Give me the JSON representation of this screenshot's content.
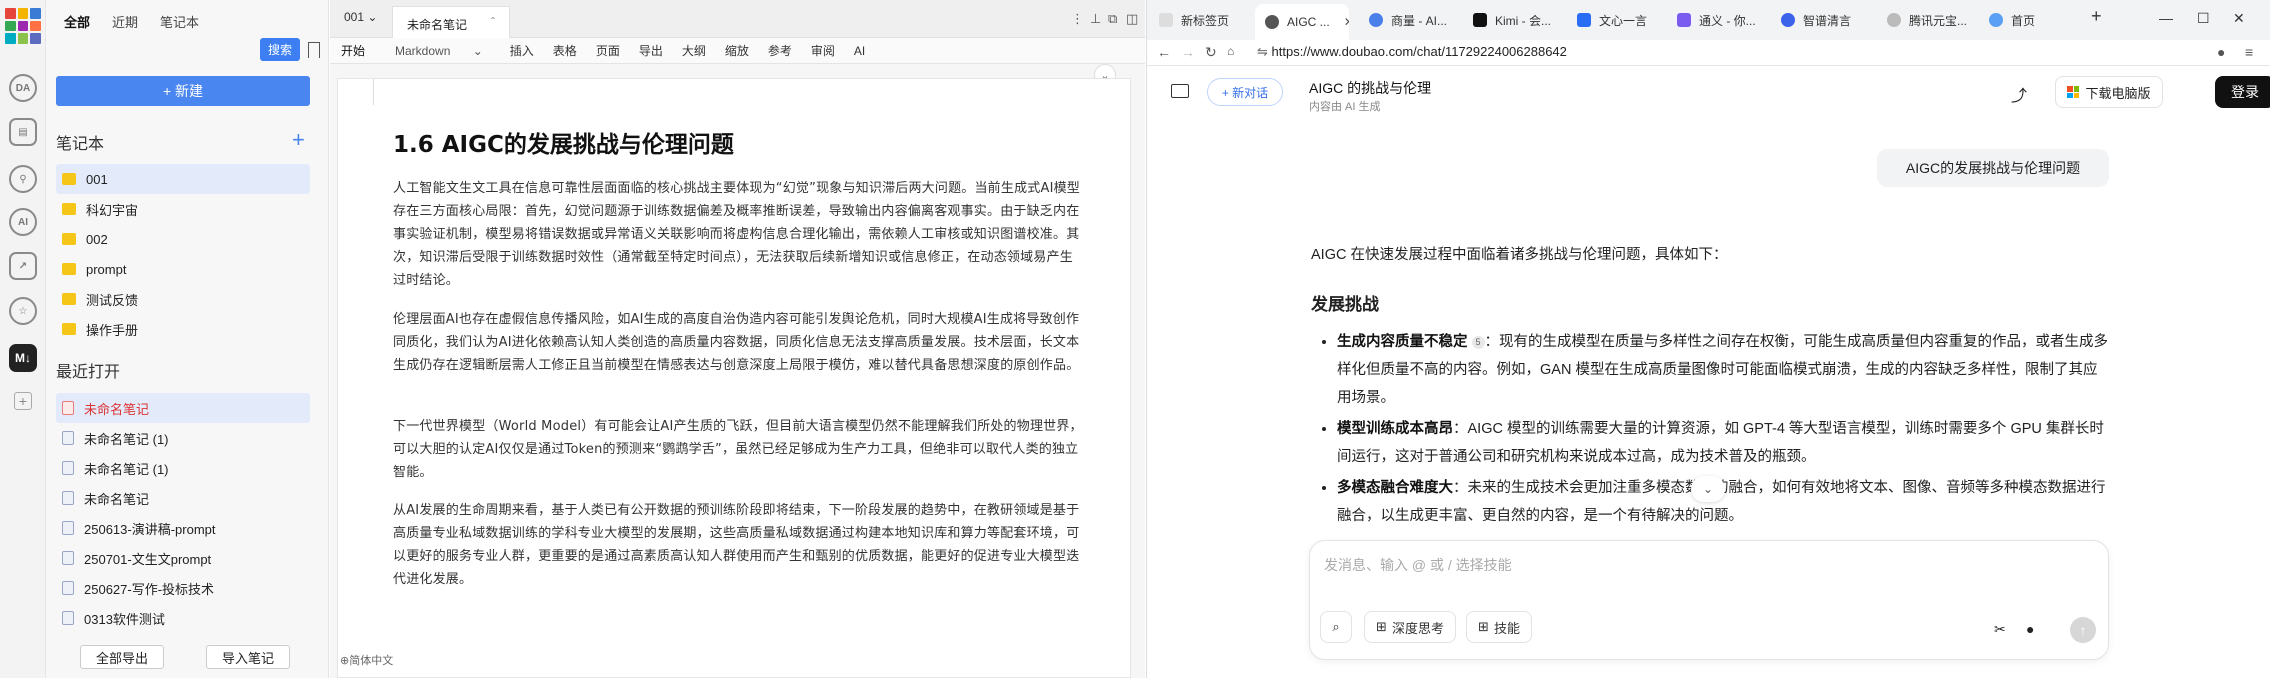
{
  "colors": {
    "accent": "#4a86f0",
    "selected_bg": "#e3ebfb",
    "folder": "#f5c518",
    "login_bg": "#111111"
  },
  "rail": {
    "icons": [
      "app-logo",
      "openai-icon",
      "note-icon",
      "search-icon",
      "ai-icon",
      "chart-icon",
      "star-icon",
      "markdown-icon",
      "add-icon"
    ],
    "md_label": "M↓"
  },
  "sidebar": {
    "tabs": [
      "全部",
      "近期",
      "笔记本"
    ],
    "search_label": "搜索",
    "new_label": "+ 新建",
    "notebooks_title": "笔记本",
    "notebooks": [
      "001",
      "科幻宇宙",
      "002",
      "prompt",
      "测试反馈",
      "操作手册"
    ],
    "recent_title": "最近打开",
    "recent": [
      "未命名笔记",
      "未命名笔记 (1)",
      "未命名笔记 (1)",
      "未命名笔记",
      "250613-演讲稿-prompt",
      "250701-文生文prompt",
      "250627-写作-投标技术",
      "0313软件测试"
    ],
    "export_all": "全部导出",
    "import": "导入笔记"
  },
  "editor": {
    "tab_folder": "001",
    "tab_title": "未命名笔记",
    "menu": [
      "开始",
      "Markdown",
      "插入",
      "表格",
      "页面",
      "导出",
      "大纲",
      "缩放",
      "参考",
      "审阅",
      "AI"
    ],
    "heading": "1.6 AIGC的发展挑战与伦理问题",
    "paragraphs": [
      "人工智能文生文工具在信息可靠性层面面临的核心挑战主要体现为“幻觉”现象与知识滞后两大问题。当前生成式AI模型存在三方面核心局限：首先，幻觉问题源于训练数据偏差及概率推断误差，导致输出内容偏离客观事实。由于缺乏内在事实验证机制，模型易将错误数据或异常语义关联影响而将虚构信息合理化输出，需依赖人工审核或知识图谱校准。其次，知识滞后受限于训练数据时效性（通常截至特定时间点），无法获取后续新增知识或信息修正，在动态领域易产生过时结论。",
      "伦理层面AI也存在虚假信息传播风险，如AI生成的高度自治伪造内容可能引发舆论危机，同时大规模AI生成将导致创作同质化，我们认为AI进化依赖高认知人类创造的高质量内容数据，同质化信息无法支撑高质量发展。技术层面，长文本生成仍存在逻辑断层需人工修正且当前模型在情感表达与创意深度上局限于模仿，难以替代具备思想深度的原创作品。",
      "下一代世界模型（World Model）有可能会让AI产生质的飞跃，但目前大语言模型仍然不能理解我们所处的物理世界，可以大胆的认定AI仅仅是通过Token的预测来“鹦鹉学舌”，虽然已经足够成为生产力工具，但绝非可以取代人类的独立智能。",
      "从AI发展的生命周期来看，基于人类已有公开数据的预训练阶段即将结束，下一阶段发展的趋势中，在教研领域是基于高质量专业私域数据训练的学科专业大模型的发展期，这些高质量私域数据通过构建本地知识库和算力等配套环境，可以更好的服务专业人群，更重要的是通过高素质高认知人群使用而产生和甄别的优质数据，能更好的促进专业大模型迭代进化发展。"
    ],
    "status_lang": "简体中文"
  },
  "browser": {
    "tabs": [
      "新标签页",
      "AIGC ...",
      "商量 - AI...",
      "Kimi - 会...",
      "文心一言",
      "通义 - 你...",
      "智谱清言",
      "腾讯元宝...",
      "首页"
    ],
    "url": "https://www.doubao.com/chat/11729224006288642",
    "chat": {
      "new_chat": "+ 新对话",
      "title": "AIGC 的挑战与伦理",
      "subtitle": "内容由 AI 生成",
      "download": "下载电脑版",
      "login": "登录",
      "user_msg": "AIGC的发展挑战与伦理问题",
      "intro": "AIGC 在快速发展过程中面临着诸多挑战与伦理问题，具体如下：",
      "section": "发展挑战",
      "bullets": [
        {
          "title": "生成内容质量不稳定",
          "note": "5",
          "text": "：现有的生成模型在质量与多样性之间存在权衡，可能生成高质量但内容重复的作品，或者生成多样化但质量不高的内容。例如，GAN 模型在生成高质量图像时可能面临模式崩溃，生成的内容缺乏多样性，限制了其应用场景。"
        },
        {
          "title": "模型训练成本高昂",
          "note": "",
          "text": "：AIGC 模型的训练需要大量的计算资源，如 GPT-4 等大型语言模型，训练时需要多个 GPU 集群长时间运行，这对于普通公司和研究机构来说成本过高，成为技术普及的瓶颈。"
        },
        {
          "title": "多模态融合难度大",
          "note": "",
          "text": "：未来的生成技术会更加注重多模态数据的融合，如何有效地将文本、图像、音频等多种模态数据进行融合，以生成更丰富、更自然的内容，是一个有待解决的问题。"
        }
      ],
      "input_placeholder": "发消息、输入 @ 或 / 选择技能",
      "chip_deep": "深度思考",
      "chip_skill": "技能"
    }
  }
}
